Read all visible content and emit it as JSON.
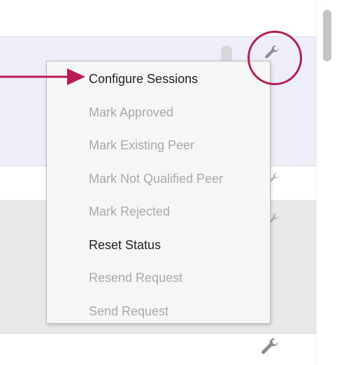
{
  "menu": {
    "items": [
      {
        "label": "Configure Sessions",
        "enabled": true
      },
      {
        "label": "Mark Approved",
        "enabled": false
      },
      {
        "label": "Mark Existing Peer",
        "enabled": false
      },
      {
        "label": "Mark Not Qualified Peer",
        "enabled": false
      },
      {
        "label": "Mark Rejected",
        "enabled": false
      },
      {
        "label": "Reset Status",
        "enabled": true
      },
      {
        "label": "Resend Request",
        "enabled": false
      },
      {
        "label": "Send Request",
        "enabled": false
      }
    ]
  },
  "icons": {
    "row_action": "wrench-icon",
    "pointer": "arrow-right-icon"
  },
  "colors": {
    "annotation": "#b81c56",
    "selected_row": "#eeeef9",
    "disabled_text": "#a9a9a9",
    "enabled_text": "#222222"
  }
}
